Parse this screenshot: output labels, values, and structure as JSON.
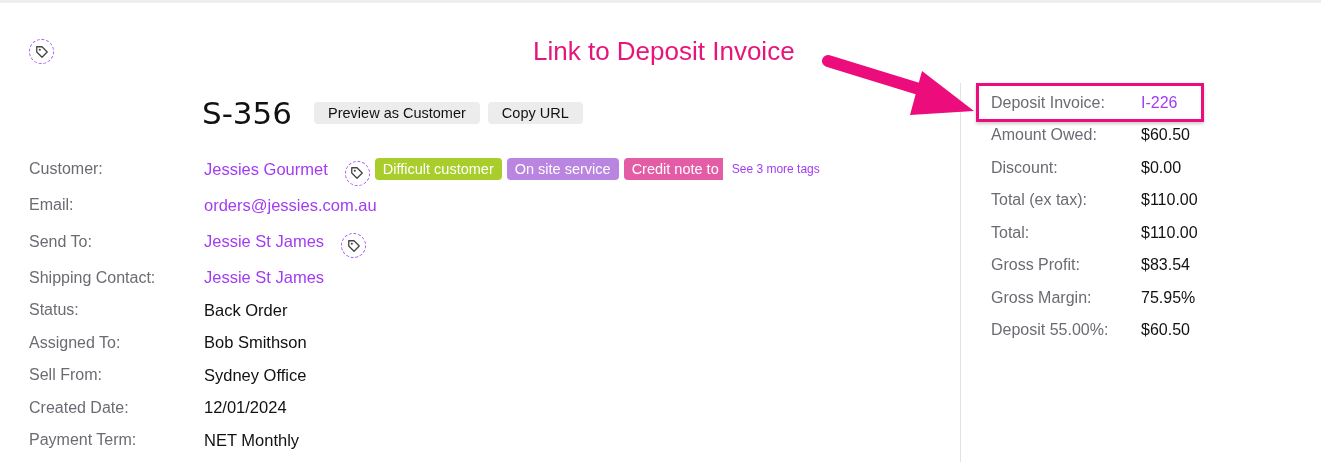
{
  "header_tag_button": true,
  "order": {
    "number": "S-356",
    "buttons": [
      "Preview as Customer",
      "Copy URL"
    ]
  },
  "fields": [
    {
      "label": "Customer:",
      "value": "Jessies Gourmet",
      "kind": "link",
      "tag_button": true,
      "tags": [
        {
          "label": "Difficult customer",
          "color": "#a9cd2a"
        },
        {
          "label": "On site service",
          "color": "#b985e0"
        },
        {
          "label": "Credit note to",
          "color": "#e45ba6"
        }
      ],
      "more_tags": "See 3 more tags"
    },
    {
      "label": "Email:",
      "value": "orders@jessies.com.au",
      "kind": "link",
      "tag_button": false
    },
    {
      "label": "Send To:",
      "value": "Jessie St James",
      "kind": "link",
      "tag_button": true
    },
    {
      "label": "Shipping Contact:",
      "value": "Jessie St James",
      "kind": "link",
      "tag_button": false
    },
    {
      "label": "Status:",
      "value": "Back Order",
      "kind": "text",
      "tag_button": false
    },
    {
      "label": "Assigned To:",
      "value": "Bob Smithson",
      "kind": "text",
      "tag_button": false
    },
    {
      "label": "Sell From:",
      "value": "Sydney Office",
      "kind": "text",
      "tag_button": false
    },
    {
      "label": "Created Date:",
      "value": "12/01/2024",
      "kind": "text",
      "tag_button": false
    },
    {
      "label": "Payment Term:",
      "value": "NET Monthly",
      "kind": "text",
      "tag_button": false
    }
  ],
  "summary": [
    {
      "label": "Deposit Invoice:",
      "value": "I-226",
      "kind": "link",
      "highlighted": true
    },
    {
      "label": "Amount Owed:",
      "value": "$60.50",
      "kind": "text",
      "highlighted": false
    },
    {
      "label": "Discount:",
      "value": "$0.00",
      "kind": "text",
      "highlighted": false
    },
    {
      "label": "Total (ex tax):",
      "value": "$110.00",
      "kind": "text",
      "highlighted": false
    },
    {
      "label": "Total:",
      "value": "$110.00",
      "kind": "text",
      "highlighted": false
    },
    {
      "label": "Gross Profit:",
      "value": "$83.54",
      "kind": "text",
      "highlighted": false
    },
    {
      "label": "Gross Margin:",
      "value": "75.95%",
      "kind": "text",
      "highlighted": false
    },
    {
      "label": "Deposit 55.00%:",
      "value": "$60.50",
      "kind": "text",
      "highlighted": false
    }
  ],
  "annotation": {
    "text": "Link to Deposit Invoice"
  }
}
